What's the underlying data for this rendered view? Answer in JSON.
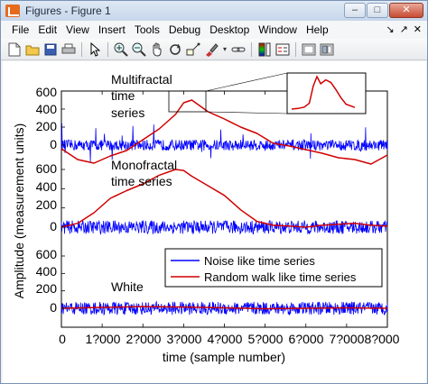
{
  "window": {
    "title": "Figures - Figure 1",
    "buttons": {
      "minimize": "–",
      "maximize": "□",
      "close": "✕"
    }
  },
  "menu": {
    "items": [
      "File",
      "Edit",
      "View",
      "Insert",
      "Tools",
      "Debug",
      "Desktop",
      "Window",
      "Help"
    ],
    "right_icons": [
      "↘",
      "↗",
      "✕"
    ]
  },
  "toolbar": {
    "buttons": [
      "new-figure-icon",
      "open-icon",
      "save-icon",
      "print-icon",
      "pointer-icon",
      "zoom-in-icon",
      "zoom-out-icon",
      "pan-icon",
      "rotate-icon",
      "data-cursor-icon",
      "brush-icon",
      "link-icon",
      "colorbar-icon",
      "legend-icon",
      "hide-plot-tools-icon",
      "show-plot-tools-icon"
    ]
  },
  "chart_data": {
    "type": "line",
    "xlabel": "time (sample number)",
    "ylabel": "Amplitude (measurement units)",
    "x_tick_labels": [
      "0",
      "1?000",
      "2?000",
      "3?000",
      "4?000",
      "5?000",
      "6?000",
      "7?000",
      "8?000"
    ],
    "xlim": [
      0,
      8000
    ],
    "y_tick_labels": [
      "600",
      "400",
      "200",
      "0",
      "600",
      "400",
      "200",
      "0",
      "600",
      "400",
      "200",
      "0"
    ],
    "annotations": [
      "Multifractal",
      "time",
      "series",
      "Monofractal",
      "time series",
      "White"
    ],
    "legend": {
      "placement": "lower-right",
      "entries": [
        {
          "label": "Noise like time series",
          "color": "#0000ff"
        },
        {
          "label": "Random walk like time series",
          "color": "#d00000"
        }
      ]
    },
    "series": [
      {
        "name": "Random walk like time series",
        "color": "#d00000",
        "panel": "multifractal",
        "x": [
          0,
          400,
          800,
          1200,
          1600,
          2000,
          2400,
          2800,
          3000,
          3200,
          3600,
          4000,
          4400,
          4800,
          5200,
          5600,
          6000,
          6400,
          6800,
          7200,
          7600,
          8000
        ],
        "values": [
          -40,
          -160,
          -200,
          -120,
          -60,
          60,
          180,
          340,
          470,
          500,
          370,
          290,
          200,
          130,
          20,
          -10,
          -50,
          -90,
          -140,
          -160,
          -210,
          -110
        ]
      },
      {
        "name": "Noise like time series",
        "color": "#0000ff",
        "panel": "multifractal",
        "amplitude": 60
      },
      {
        "name": "Random walk like time series",
        "color": "#d00000",
        "panel": "monofractal",
        "x": [
          0,
          400,
          800,
          1200,
          1600,
          2000,
          2400,
          2800,
          3000,
          3200,
          3600,
          4000,
          4400,
          4800,
          5200,
          5600,
          6000,
          6400,
          6800,
          7200,
          7600,
          8000
        ],
        "values": [
          0,
          40,
          150,
          300,
          380,
          450,
          540,
          600,
          590,
          530,
          430,
          330,
          180,
          60,
          20,
          10,
          0,
          20,
          30,
          40,
          20,
          10
        ]
      },
      {
        "name": "Noise like time series",
        "color": "#0000ff",
        "panel": "monofractal",
        "amplitude": 70
      },
      {
        "name": "Random walk like time series",
        "color": "#d00000",
        "panel": "white",
        "x": [
          0,
          1000,
          2000,
          3000,
          4000,
          5000,
          6000,
          7000,
          8000
        ],
        "values": [
          0,
          10,
          20,
          15,
          5,
          -5,
          0,
          5,
          0
        ]
      },
      {
        "name": "Noise like time series",
        "color": "#0000ff",
        "panel": "white",
        "amplitude": 75
      }
    ],
    "inset": {
      "x": [
        0,
        10,
        20,
        28,
        34,
        40,
        46,
        54,
        62,
        70,
        78,
        86,
        100
      ],
      "values": [
        0,
        2,
        6,
        18,
        70,
        100,
        78,
        90,
        82,
        60,
        35,
        15,
        5
      ]
    }
  }
}
